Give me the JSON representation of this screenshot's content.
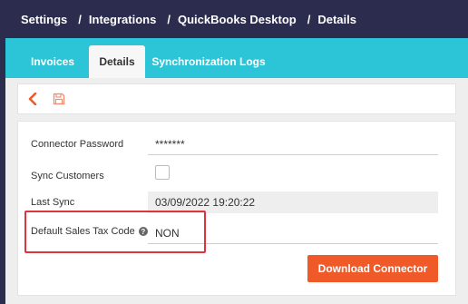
{
  "breadcrumb": {
    "items": [
      "Settings",
      "Integrations",
      "QuickBooks Desktop",
      "Details"
    ],
    "separator": "/"
  },
  "tabs": [
    {
      "label": "Invoices",
      "active": false
    },
    {
      "label": "Details",
      "active": true
    },
    {
      "label": "Synchronization Logs",
      "active": false
    }
  ],
  "toolbar": {
    "back_icon": "chevron-left-icon",
    "save_icon": "floppy-disk-icon"
  },
  "form": {
    "connector_password": {
      "label": "Connector Password",
      "value": "*******"
    },
    "sync_customers": {
      "label": "Sync Customers",
      "checked": false
    },
    "last_sync": {
      "label": "Last Sync",
      "value": "03/09/2022 19:20:22"
    },
    "default_sales_tax_code": {
      "label": "Default Sales Tax Code",
      "value": "NON",
      "help_icon": "question-circle-icon"
    }
  },
  "download_button": {
    "label": "Download Connector"
  },
  "colors": {
    "header_bg": "#2b2c4e",
    "tab_bar_bg": "#2bc5d7",
    "accent_orange": "#f05a28",
    "highlight_red": "#e0333a"
  }
}
